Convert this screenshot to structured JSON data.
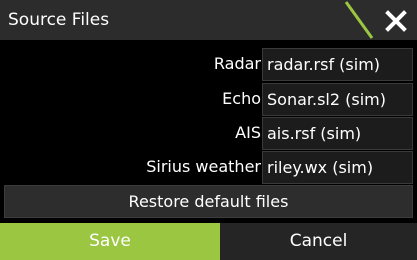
{
  "dialog": {
    "title": "Source Files",
    "accent_color": "#9bc642",
    "close_icon": "close-icon"
  },
  "rows": [
    {
      "label": "Radar",
      "value": "radar.rsf (sim)"
    },
    {
      "label": "Echo",
      "value": "Sonar.sl2 (sim)"
    },
    {
      "label": "AIS",
      "value": "ais.rsf (sim)"
    },
    {
      "label": "Sirius weather",
      "value": "riley.wx (sim)"
    }
  ],
  "buttons": {
    "restore_label": "Restore default files",
    "save_label": "Save",
    "cancel_label": "Cancel",
    "save_color": "#9bc642"
  }
}
